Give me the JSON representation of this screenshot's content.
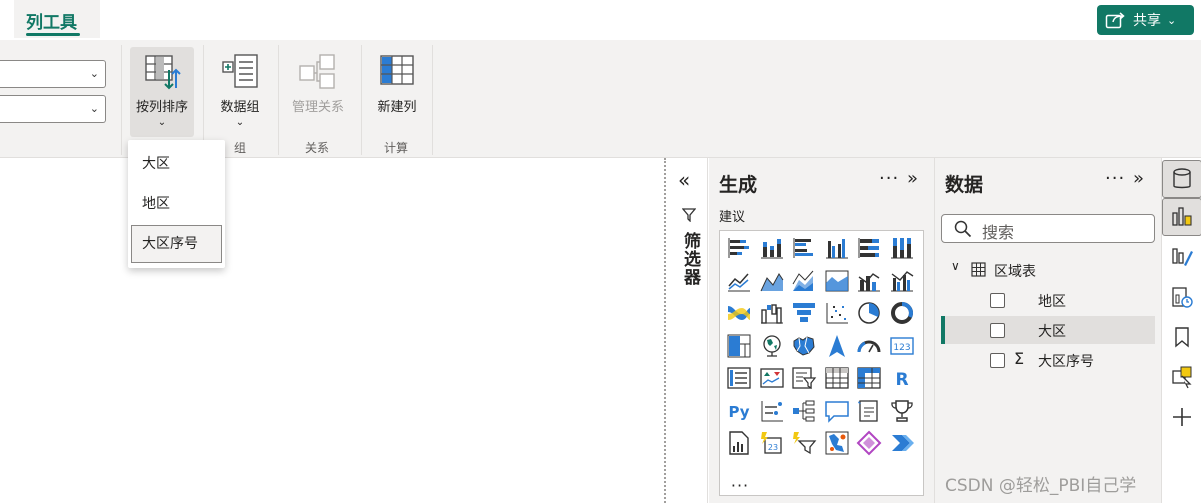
{
  "tabs": [
    {
      "label": "列工具",
      "active": true
    }
  ],
  "share": {
    "label": "共享",
    "icon": "share-icon"
  },
  "ribbon": {
    "buttons": [
      {
        "label": "按列排序",
        "icon": "sort-by-column-icon",
        "has_dropdown": true,
        "pressed": true
      },
      {
        "label": "数据组",
        "icon": "data-groups-icon",
        "has_dropdown": true
      },
      {
        "label": "管理关系",
        "icon": "manage-relationships-icon",
        "disabled": true
      },
      {
        "label": "新建列",
        "icon": "new-column-icon"
      }
    ],
    "groups": [
      "组",
      "关系",
      "计算"
    ]
  },
  "sort_menu": {
    "items": [
      "大区",
      "地区",
      "大区序号"
    ],
    "selected": "大区序号"
  },
  "filters_pane": {
    "label": "筛选器"
  },
  "build_pane": {
    "title": "生成",
    "more": "···",
    "suggest_label": "建议",
    "overflow": "···",
    "visuals": [
      "stacked-bar-chart",
      "stacked-column-chart",
      "clustered-bar-chart",
      "clustered-column-chart",
      "100-stacked-bar-chart",
      "100-stacked-column-chart",
      "line-chart",
      "area-chart",
      "stacked-area-chart",
      "100-stacked-area-chart",
      "line-and-stacked-column-chart",
      "line-and-clustered-column-chart",
      "ribbon-chart",
      "waterfall-chart",
      "funnel-chart",
      "scatter-chart",
      "pie-chart",
      "donut-chart",
      "treemap",
      "map",
      "filled-map",
      "azure-map",
      "gauge",
      "card",
      "multi-row-card",
      "kpi",
      "slicer",
      "table",
      "matrix",
      "r-visual",
      "python-visual",
      "key-influencers",
      "decomposition-tree",
      "qa",
      "smart-narrative",
      "metrics",
      "paginated-report",
      "power-apps",
      "power-automate",
      "arcgis-map",
      "power-apps-icon",
      "power-automate-icon"
    ]
  },
  "data_pane": {
    "title": "数据",
    "more": "···",
    "search_placeholder": "搜索",
    "table": {
      "name": "区域表",
      "fields": [
        {
          "name": "地区",
          "selected": false,
          "sigma": false
        },
        {
          "name": "大区",
          "selected": true,
          "sigma": false
        },
        {
          "name": "大区序号",
          "selected": false,
          "sigma": true
        }
      ]
    },
    "watermark": "CSDN @轻松_PBI自己学"
  },
  "rail": [
    "data-icon",
    "build-visual-icon",
    "format-icon",
    "analytics-icon",
    "bookmark-icon",
    "selection-icon",
    "add-icon"
  ]
}
